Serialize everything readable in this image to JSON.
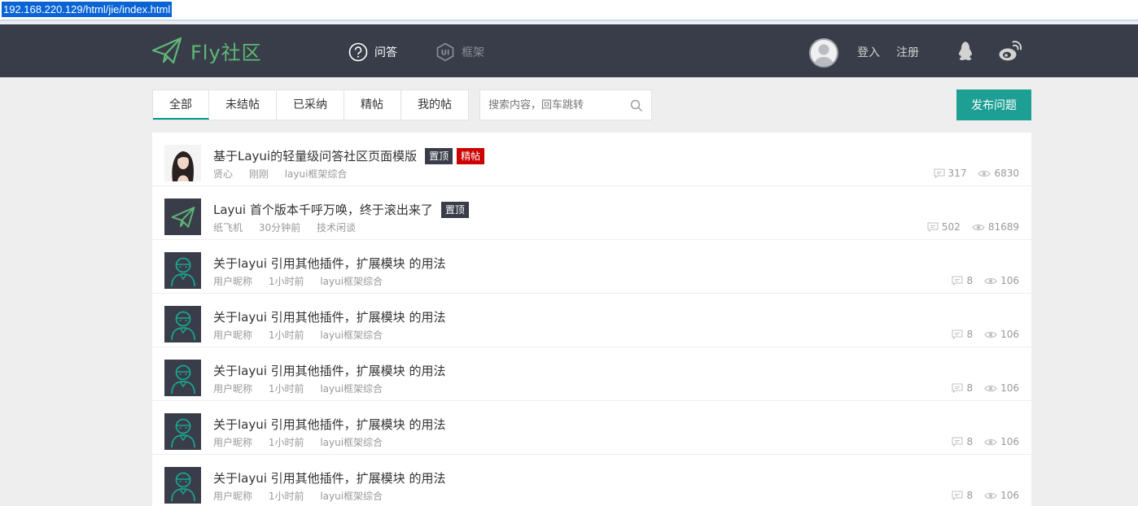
{
  "browser": {
    "url": "192.168.220.129/html/jie/index.html"
  },
  "header": {
    "logo_text": "Fly社区",
    "nav": [
      {
        "label": "问答",
        "icon": "question-circle-icon",
        "active": true
      },
      {
        "label": "框架",
        "icon": "ui-badge-icon",
        "active": false
      }
    ],
    "login_label": "登入",
    "register_label": "注册"
  },
  "filters": {
    "tabs": [
      "全部",
      "未结帖",
      "已采纳",
      "精帖",
      "我的帖"
    ],
    "active_tab": 0,
    "search_placeholder": "搜索内容，回车跳转",
    "post_button": "发布问题"
  },
  "colors": {
    "header_bg": "#393d49",
    "brand_green": "#5fb878",
    "accent": "#1e9f94",
    "hot_badge": "#cc0000"
  },
  "posts": [
    {
      "title": "基于Layui的轻量级问答社区页面模版",
      "badges": [
        "置顶",
        "精帖"
      ],
      "author": "贤心",
      "time": "刚刚",
      "category": "layui框架综合",
      "comments": "317",
      "views": "6830",
      "avatar": "photo"
    },
    {
      "title": "Layui 首个版本千呼万唤，终于滚出来了",
      "badges": [
        "置顶"
      ],
      "author": "纸飞机",
      "time": "30分钟前",
      "category": "技术闲谈",
      "comments": "502",
      "views": "81689",
      "avatar": "plane"
    },
    {
      "title": "关于layui 引用其他插件，扩展模块 的用法",
      "badges": [],
      "author": "用户昵称",
      "time": "1小时前",
      "category": "layui框架综合",
      "comments": "8",
      "views": "106",
      "avatar": "user"
    },
    {
      "title": "关于layui 引用其他插件，扩展模块 的用法",
      "badges": [],
      "author": "用户昵称",
      "time": "1小时前",
      "category": "layui框架综合",
      "comments": "8",
      "views": "106",
      "avatar": "user"
    },
    {
      "title": "关于layui 引用其他插件，扩展模块 的用法",
      "badges": [],
      "author": "用户昵称",
      "time": "1小时前",
      "category": "layui框架综合",
      "comments": "8",
      "views": "106",
      "avatar": "user"
    },
    {
      "title": "关于layui 引用其他插件，扩展模块 的用法",
      "badges": [],
      "author": "用户昵称",
      "time": "1小时前",
      "category": "layui框架综合",
      "comments": "8",
      "views": "106",
      "avatar": "user"
    },
    {
      "title": "关于layui 引用其他插件，扩展模块 的用法",
      "badges": [],
      "author": "用户昵称",
      "time": "1小时前",
      "category": "layui框架综合",
      "comments": "8",
      "views": "106",
      "avatar": "user"
    }
  ]
}
